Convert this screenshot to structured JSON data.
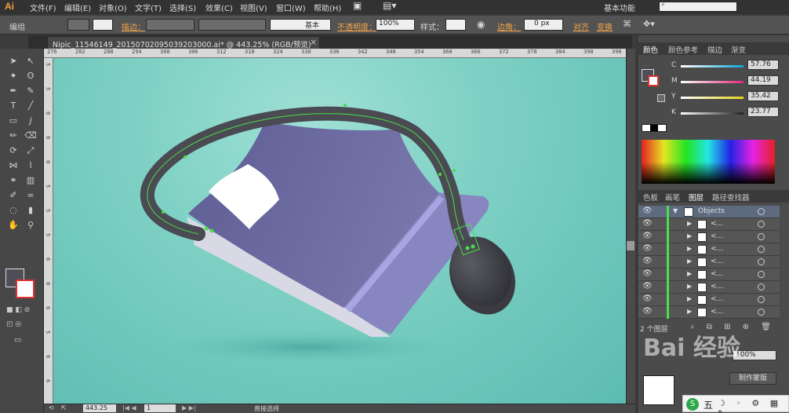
{
  "app": {
    "logo": "Ai",
    "workspace": "基本功能"
  },
  "menu": [
    "文件(F)",
    "编辑(E)",
    "对象(O)",
    "文字(T)",
    "选择(S)",
    "效果(C)",
    "视图(V)",
    "窗口(W)",
    "帮助(H)"
  ],
  "control": {
    "selection_label": "编组",
    "stroke_label": "描边：",
    "stroke_style": "基本",
    "opacity_label": "不透明度：",
    "opacity_value": "100%",
    "style_label": "样式：",
    "corner_label": "边角：",
    "corner_value": "0 px",
    "align_label": "对齐",
    "transform_label": "变换"
  },
  "document": {
    "tab_title": "Nipic_11546149_20150702095039203000.ai* @ 443.25% (RGB/预览)",
    "close_glyph": "×"
  },
  "rulers": {
    "top": [
      "276",
      "282",
      "288",
      "294",
      "300",
      "306",
      "312",
      "318",
      "324",
      "330",
      "336",
      "342",
      "348",
      "354",
      "360",
      "366",
      "372",
      "378",
      "384",
      "390",
      "396"
    ],
    "left": [
      "5",
      "5",
      "0",
      "0",
      "0",
      "5",
      "5",
      "5",
      "6",
      "0",
      "6",
      "5",
      "6",
      "6"
    ]
  },
  "panels": {
    "color_tabs": [
      "颜色",
      "颜色参考",
      "描边",
      "渐变"
    ],
    "color_sliders": [
      {
        "label": "C",
        "value": "57.76",
        "color": "#0aa5d8"
      },
      {
        "label": "M",
        "value": "44.19",
        "color": "#e0287a"
      },
      {
        "label": "Y",
        "value": "35.42",
        "color": "#e6d21e"
      },
      {
        "label": "K",
        "value": "23.77",
        "color": "#222222"
      }
    ],
    "layer_tabs": [
      "色板",
      "画笔",
      "图层",
      "路径查找器"
    ],
    "layers": {
      "main": "Objects",
      "items": [
        "<...",
        "<...",
        "<...",
        "<...",
        "<...",
        "<...",
        "<...",
        "<..."
      ],
      "footer_count": "2 个图层"
    },
    "opacity_small": "100%",
    "mask_button": "制作蒙版"
  },
  "status": {
    "zoom": "443.25",
    "page": "1",
    "tool_name": "直接选择"
  },
  "watermark": "Bai 经验",
  "ime": {
    "label": "五"
  },
  "colors": {
    "canvas_bg": "#7ed0c4",
    "book_cover": "#6b6aa3",
    "cable": "#4a4a52",
    "selection": "#4ae04a"
  },
  "icons": [
    "selection-icon",
    "direct-select-icon",
    "magic-wand-icon",
    "lasso-icon",
    "pen-icon",
    "type-icon",
    "line-icon",
    "rectangle-icon",
    "brush-icon",
    "pencil-icon",
    "rotate-icon",
    "scale-icon",
    "width-icon",
    "warp-icon",
    "shape-builder-icon",
    "gradient-icon",
    "eyedropper-icon",
    "blend-icon",
    "symbol-sprayer-icon",
    "graph-icon",
    "artboard-icon",
    "slice-icon",
    "hand-icon",
    "zoom-icon"
  ]
}
